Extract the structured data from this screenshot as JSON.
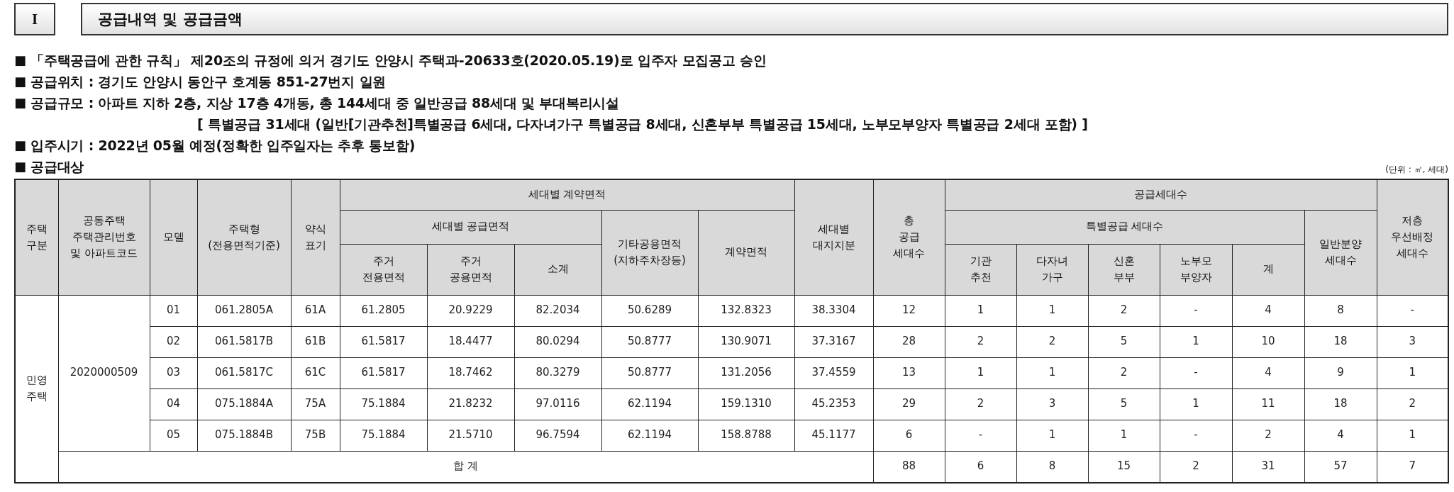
{
  "section": {
    "number": "I",
    "title": "공급내역 및 공급금액"
  },
  "notes": [
    {
      "kind": "bullet",
      "marker": "■",
      "text": "「주택공급에 관한 규칙」 제20조의 규정에 의거 경기도 안양시 주택과-20633호(2020.05.19)로 입주자 모집공고 승인"
    },
    {
      "kind": "bullet",
      "marker": "■",
      "text": "공급위치 : 경기도 안양시 동안구 호계동 851-27번지 일원"
    },
    {
      "kind": "bullet",
      "marker": "■",
      "text": "공급규모 : 아파트 지하 2층, 지상 17층 4개동, 총 144세대 중 일반공급 88세대 및 부대복리시설"
    },
    {
      "kind": "continuation",
      "text": "[ 특별공급 31세대 (일반[기관추천]특별공급 6세대, 다자녀가구 특별공급 8세대, 신혼부부 특별공급 15세대, 노부모부양자 특별공급 2세대 포함) ]"
    },
    {
      "kind": "bullet",
      "marker": "■",
      "text": "입주시기 : 2022년 05월 예정(정확한 입주일자는 추후 통보함)"
    },
    {
      "kind": "bullet",
      "marker": "■",
      "text": "공급대상"
    }
  ],
  "unit_note": "(단위 : ㎡, 세대)",
  "table": {
    "columns": [
      {
        "label": "주택\n구분"
      },
      {
        "label": "공동주택\n주택관리번호\n및 아파트코드"
      },
      {
        "label": "모델"
      },
      {
        "label": "주택형\n(전용면적기준)"
      },
      {
        "label": "약식\n표기"
      },
      {
        "label": "세대별 계약면적",
        "children": [
          {
            "label": "세대별 공급면적",
            "children": [
              {
                "label": "주거\n전용면적"
              },
              {
                "label": "주거\n공용면적"
              },
              {
                "label": "소계"
              }
            ]
          },
          {
            "label": "기타공용면적\n(지하주차장등)"
          },
          {
            "label": "계약면적"
          }
        ]
      },
      {
        "label": "세대별\n대지지분"
      },
      {
        "label": "총\n공급\n세대수"
      },
      {
        "label": "공급세대수",
        "children": [
          {
            "label": "특별공급 세대수",
            "children": [
              {
                "label": "기관\n추천"
              },
              {
                "label": "다자녀\n가구"
              },
              {
                "label": "신혼\n부부"
              },
              {
                "label": "노부모\n부양자"
              },
              {
                "label": "계"
              }
            ]
          },
          {
            "label": "일반분양\n세대수"
          }
        ]
      },
      {
        "label": "저층\n우선배정\n세대수"
      }
    ],
    "group": {
      "housing_type": "민영\n주택",
      "code": "2020000509",
      "rows": [
        [
          "01",
          "061.2805A",
          "61A",
          "61.2805",
          "20.9229",
          "82.2034",
          "50.6289",
          "132.8323",
          "38.3304",
          "12",
          "1",
          "1",
          "2",
          "-",
          "4",
          "8",
          "-"
        ],
        [
          "02",
          "061.5817B",
          "61B",
          "61.5817",
          "18.4477",
          "80.0294",
          "50.8777",
          "130.9071",
          "37.3167",
          "28",
          "2",
          "2",
          "5",
          "1",
          "10",
          "18",
          "3"
        ],
        [
          "03",
          "061.5817C",
          "61C",
          "61.5817",
          "18.7462",
          "80.3279",
          "50.8777",
          "131.2056",
          "37.4559",
          "13",
          "1",
          "1",
          "2",
          "-",
          "4",
          "9",
          "1"
        ],
        [
          "04",
          "075.1884A",
          "75A",
          "75.1884",
          "21.8232",
          "97.0116",
          "62.1194",
          "159.1310",
          "45.2353",
          "29",
          "2",
          "3",
          "5",
          "1",
          "11",
          "18",
          "2"
        ],
        [
          "05",
          "075.1884B",
          "75B",
          "75.1884",
          "21.5710",
          "96.7594",
          "62.1194",
          "158.8788",
          "45.1177",
          "6",
          "-",
          "1",
          "1",
          "-",
          "2",
          "4",
          "1"
        ]
      ]
    },
    "total": {
      "label": "합 계",
      "values": [
        "88",
        "6",
        "8",
        "15",
        "2",
        "31",
        "57",
        "7"
      ]
    }
  }
}
